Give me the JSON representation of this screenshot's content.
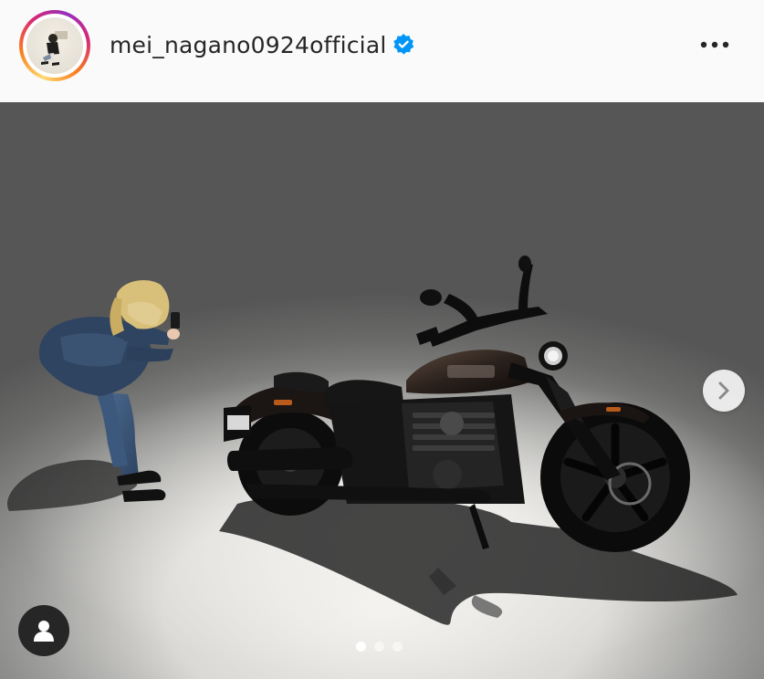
{
  "post": {
    "username": "mei_nagano0924official",
    "verified": true,
    "verified_color": "#0095f6",
    "more_icon": "more-horizontal-icon"
  },
  "carousel": {
    "slide_count": 3,
    "active_index": 0,
    "next_icon": "chevron-right-icon",
    "tag_icon": "user-tag-icon"
  }
}
